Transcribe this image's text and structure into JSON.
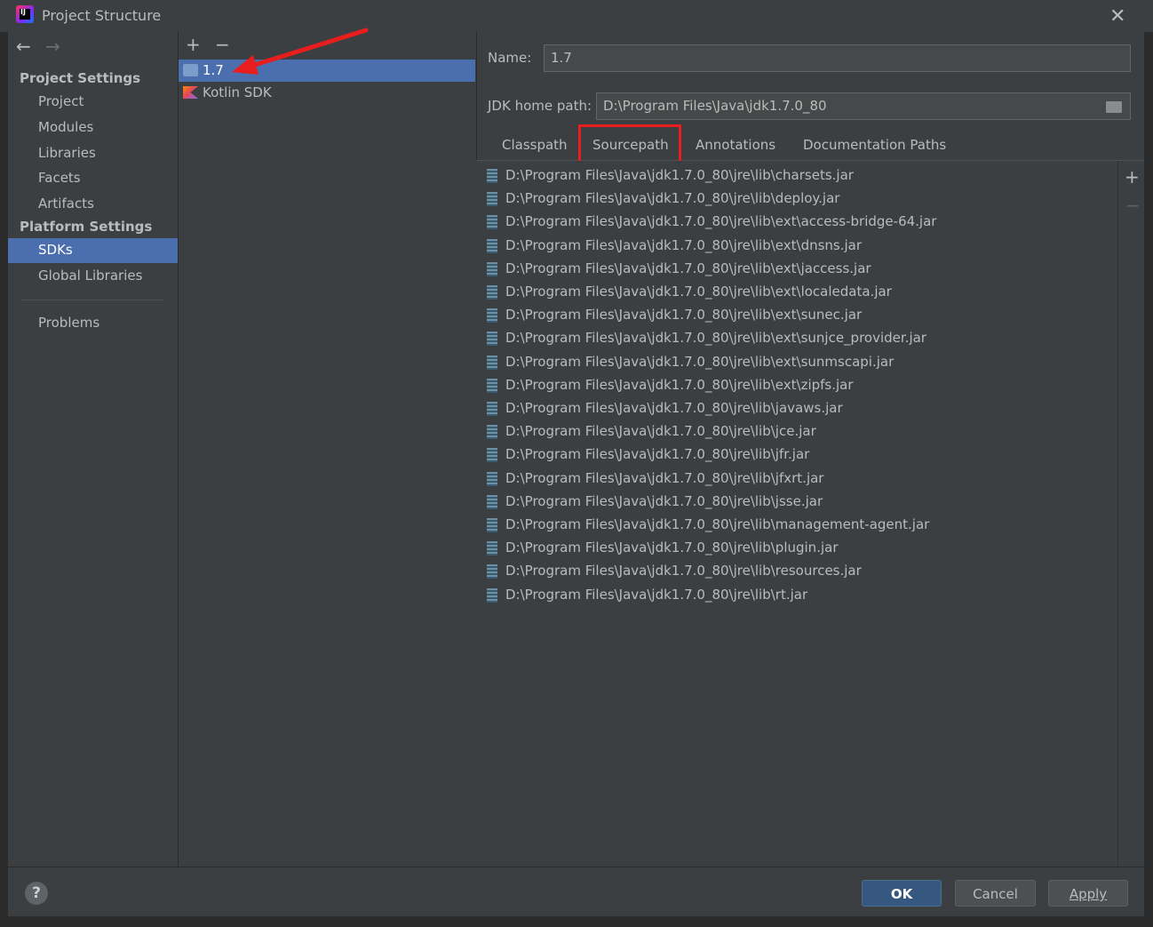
{
  "window": {
    "title": "Project Structure",
    "close_glyph": "✕",
    "app_icon": "intellij-idea-icon",
    "app_icon_text": "IJ"
  },
  "nav": {
    "back_glyph": "←",
    "forward_glyph": "→"
  },
  "sidebar": {
    "project_settings_header": "Project Settings",
    "project_items": [
      "Project",
      "Modules",
      "Libraries",
      "Facets",
      "Artifacts"
    ],
    "platform_settings_header": "Platform Settings",
    "platform_items": [
      "SDKs",
      "Global Libraries"
    ],
    "selected_item": "SDKs",
    "problems": "Problems"
  },
  "sdk_toolbar": {
    "add_glyph": "+",
    "remove_glyph": "−"
  },
  "sdk_list": [
    {
      "label": "1.7",
      "icon": "jdk-folder-icon",
      "selected": true
    },
    {
      "label": "Kotlin SDK",
      "icon": "kotlin-icon",
      "selected": false
    }
  ],
  "details": {
    "name_label": "Name:",
    "name_value": "1.7",
    "jdk_home_label": "JDK home path:",
    "jdk_home_value": "D:\\Program Files\\Java\\jdk1.7.0_80",
    "tabs": [
      "Classpath",
      "Sourcepath",
      "Annotations",
      "Documentation Paths"
    ],
    "highlighted_tab": "Sourcepath",
    "add_glyph": "+",
    "remove_glyph": "−",
    "paths": [
      "D:\\Program Files\\Java\\jdk1.7.0_80\\jre\\lib\\charsets.jar",
      "D:\\Program Files\\Java\\jdk1.7.0_80\\jre\\lib\\deploy.jar",
      "D:\\Program Files\\Java\\jdk1.7.0_80\\jre\\lib\\ext\\access-bridge-64.jar",
      "D:\\Program Files\\Java\\jdk1.7.0_80\\jre\\lib\\ext\\dnsns.jar",
      "D:\\Program Files\\Java\\jdk1.7.0_80\\jre\\lib\\ext\\jaccess.jar",
      "D:\\Program Files\\Java\\jdk1.7.0_80\\jre\\lib\\ext\\localedata.jar",
      "D:\\Program Files\\Java\\jdk1.7.0_80\\jre\\lib\\ext\\sunec.jar",
      "D:\\Program Files\\Java\\jdk1.7.0_80\\jre\\lib\\ext\\sunjce_provider.jar",
      "D:\\Program Files\\Java\\jdk1.7.0_80\\jre\\lib\\ext\\sunmscapi.jar",
      "D:\\Program Files\\Java\\jdk1.7.0_80\\jre\\lib\\ext\\zipfs.jar",
      "D:\\Program Files\\Java\\jdk1.7.0_80\\jre\\lib\\javaws.jar",
      "D:\\Program Files\\Java\\jdk1.7.0_80\\jre\\lib\\jce.jar",
      "D:\\Program Files\\Java\\jdk1.7.0_80\\jre\\lib\\jfr.jar",
      "D:\\Program Files\\Java\\jdk1.7.0_80\\jre\\lib\\jfxrt.jar",
      "D:\\Program Files\\Java\\jdk1.7.0_80\\jre\\lib\\jsse.jar",
      "D:\\Program Files\\Java\\jdk1.7.0_80\\jre\\lib\\management-agent.jar",
      "D:\\Program Files\\Java\\jdk1.7.0_80\\jre\\lib\\plugin.jar",
      "D:\\Program Files\\Java\\jdk1.7.0_80\\jre\\lib\\resources.jar",
      "D:\\Program Files\\Java\\jdk1.7.0_80\\jre\\lib\\rt.jar"
    ]
  },
  "footer": {
    "help": "?",
    "ok": "OK",
    "cancel": "Cancel",
    "apply": "Apply"
  },
  "colors": {
    "background": "#3c3f41",
    "selection": "#4b6eaf",
    "annotation": "#e81e1e",
    "ok_button": "#365880"
  }
}
